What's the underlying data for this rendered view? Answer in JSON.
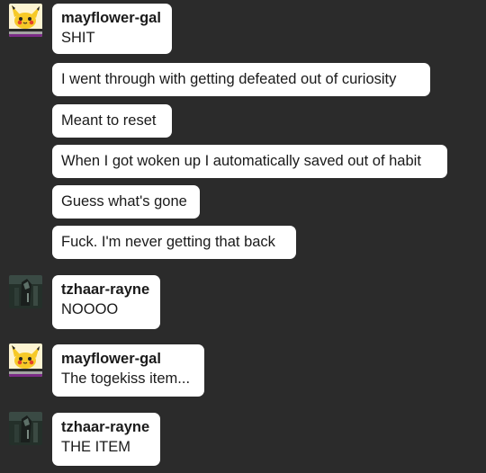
{
  "chat": {
    "groups": [
      {
        "sender": "mayflower-gal",
        "avatar_icon": "pikachu-avatar-icon",
        "messages": [
          "SHIT",
          "I went through with getting defeated out of curiosity",
          "Meant to reset",
          "When I got woken up I automatically saved out of habit",
          "Guess what's gone",
          "Fuck. I'm never getting that back"
        ]
      },
      {
        "sender": "tzhaar-rayne",
        "avatar_icon": "dark-character-avatar-icon",
        "messages": [
          "NOOOO"
        ]
      },
      {
        "sender": "mayflower-gal",
        "avatar_icon": "pikachu-avatar-icon",
        "messages": [
          "The togekiss item..."
        ]
      },
      {
        "sender": "tzhaar-rayne",
        "avatar_icon": "dark-character-avatar-icon",
        "messages": [
          "THE ITEM"
        ]
      }
    ]
  },
  "colors": {
    "background": "#2b2b2b",
    "bubble": "#ffffff",
    "text": "#1a1a1a"
  }
}
